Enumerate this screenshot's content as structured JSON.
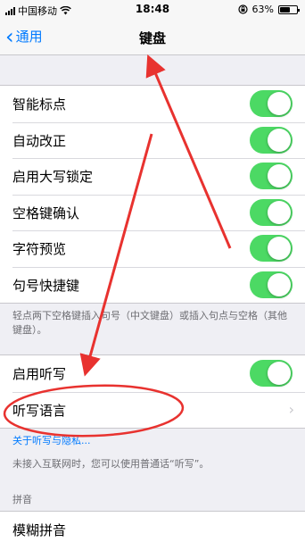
{
  "status_bar": {
    "carrier": "中国移动",
    "time": "18:48",
    "battery_percent": "63%",
    "battery_level": 0.63,
    "icons": [
      "signal-icon",
      "wifi-icon",
      "rotation-lock-icon",
      "battery-icon"
    ]
  },
  "nav": {
    "back_label": "通用",
    "title": "键盘"
  },
  "keyboard_toggles": [
    {
      "label": "智能标点",
      "on": true
    },
    {
      "label": "自动改正",
      "on": true
    },
    {
      "label": "启用大写锁定",
      "on": true
    },
    {
      "label": "空格键确认",
      "on": true
    },
    {
      "label": "字符预览",
      "on": true
    },
    {
      "label": "句号快捷键",
      "on": true
    }
  ],
  "shortcut_footer": "轻点两下空格键插入句号（中文键盘）或插入句点与空格（其他键盘）。",
  "dictation": {
    "enable_label": "启用听写",
    "enable_on": true,
    "language_label": "听写语言"
  },
  "dictation_footer": {
    "link": "关于听写与隐私...",
    "note": "未接入互联网时，您可以使用普通话“听写”。"
  },
  "pinyin": {
    "header": "拼音",
    "fuzzy_label": "模糊拼音"
  },
  "annotation": {
    "color": "#e8322f"
  }
}
